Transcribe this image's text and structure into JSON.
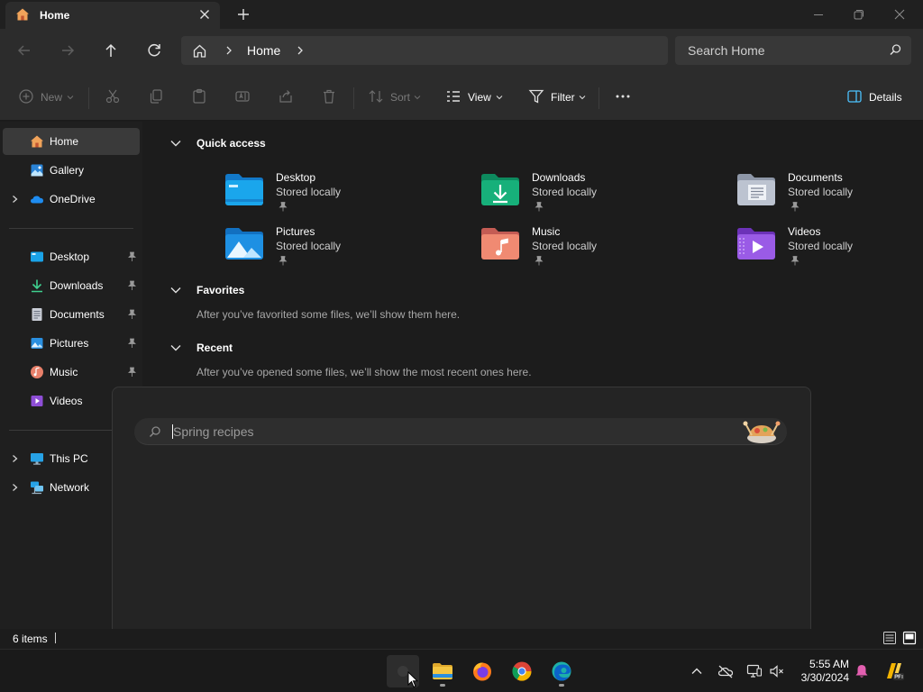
{
  "window": {
    "tab_title": "Home",
    "tab_icon": "home-icon",
    "new_tab": "+"
  },
  "address": {
    "crumb": "Home",
    "search_placeholder": "Search Home"
  },
  "commands": {
    "new": "New",
    "sort": "Sort",
    "view": "View",
    "filter": "Filter",
    "details": "Details"
  },
  "sidebar": {
    "top": [
      {
        "label": "Home",
        "icon": "home-icon",
        "selected": true
      },
      {
        "label": "Gallery",
        "icon": "gallery-icon"
      },
      {
        "label": "OneDrive",
        "icon": "onedrive-icon",
        "expandable": true
      }
    ],
    "pinned": [
      {
        "label": "Desktop",
        "icon": "desktop-icon"
      },
      {
        "label": "Downloads",
        "icon": "downloads-icon"
      },
      {
        "label": "Documents",
        "icon": "documents-icon"
      },
      {
        "label": "Pictures",
        "icon": "pictures-icon"
      },
      {
        "label": "Music",
        "icon": "music-icon"
      },
      {
        "label": "Videos",
        "icon": "videos-icon"
      }
    ],
    "bottom": [
      {
        "label": "This PC",
        "icon": "this-pc-icon",
        "expandable": true
      },
      {
        "label": "Network",
        "icon": "network-icon",
        "expandable": true
      }
    ]
  },
  "content": {
    "quick_access": {
      "title": "Quick access",
      "items": [
        {
          "name": "Desktop",
          "sub": "Stored locally",
          "icon": "desktop-folder-icon"
        },
        {
          "name": "Downloads",
          "sub": "Stored locally",
          "icon": "downloads-folder-icon"
        },
        {
          "name": "Documents",
          "sub": "Stored locally",
          "icon": "documents-folder-icon"
        },
        {
          "name": "Pictures",
          "sub": "Stored locally",
          "icon": "pictures-folder-icon"
        },
        {
          "name": "Music",
          "sub": "Stored locally",
          "icon": "music-folder-icon"
        },
        {
          "name": "Videos",
          "sub": "Stored locally",
          "icon": "videos-folder-icon"
        }
      ]
    },
    "favorites": {
      "title": "Favorites",
      "message": "After you’ve favorited some files, we’ll show them here."
    },
    "recent": {
      "title": "Recent",
      "message": "After you’ve opened some files, we’ll show the most recent ones here."
    }
  },
  "overlay": {
    "search_placeholder": "Spring recipes"
  },
  "status": {
    "item_count": "6 items"
  },
  "taskbar": {
    "apps": [
      "start-search-icon",
      "file-explorer-icon",
      "firefox-icon",
      "chrome-icon",
      "edge-icon"
    ],
    "time": "5:55 AM",
    "date": "3/30/2024"
  },
  "colors": {
    "accent": "#4cc2ff",
    "folder_yellow": "#f4c542",
    "window_bg": "#1c1c1c",
    "toolbar_bg": "#2c2c2c"
  }
}
